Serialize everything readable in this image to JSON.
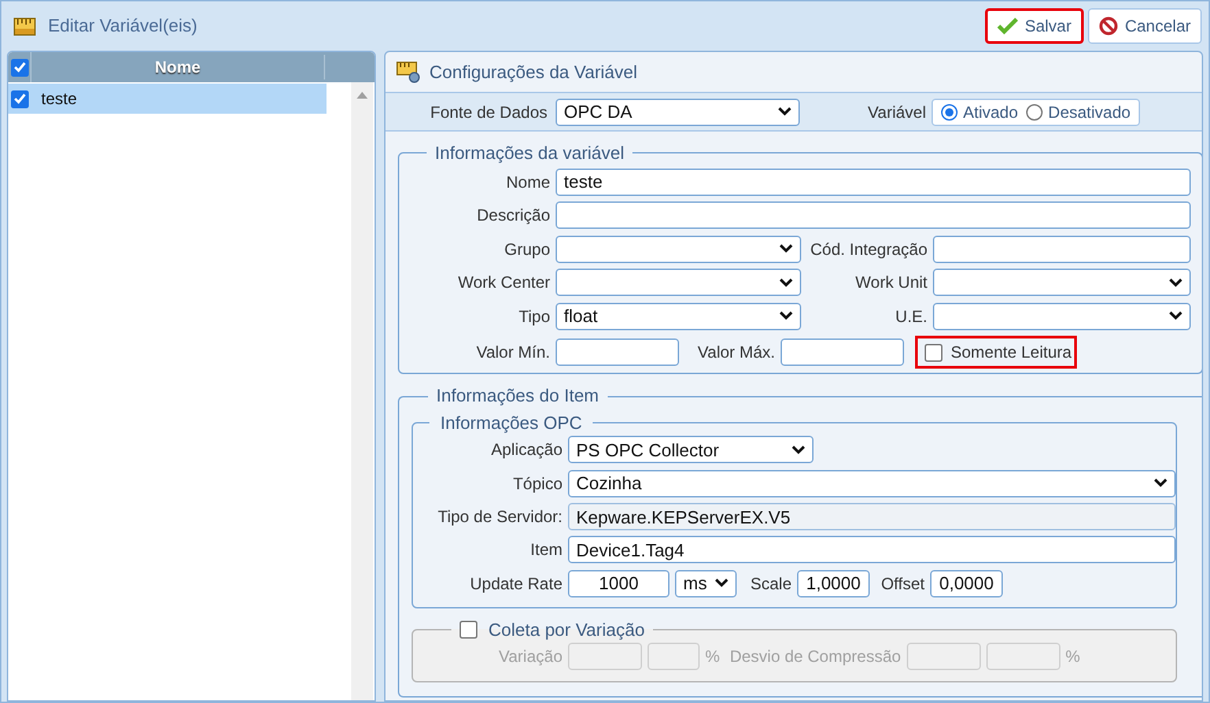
{
  "window": {
    "title": "Editar Variável(eis)"
  },
  "toolbar": {
    "buttons": [
      {
        "kind": "save",
        "label": "Salvar",
        "highlighted": true
      },
      {
        "kind": "cancel",
        "label": "Cancelar",
        "highlighted": false
      }
    ]
  },
  "list": {
    "header": {
      "label": "Nome",
      "checked": true
    },
    "rows": [
      {
        "label": "teste",
        "checked": true,
        "selected": true
      }
    ]
  },
  "config": {
    "title": "Configurações da Variável",
    "source": {
      "label": "Fonte de Dados",
      "value": "OPC DA"
    },
    "variable": {
      "label": "Variável",
      "options": [
        {
          "label": "Ativado",
          "selected": true
        },
        {
          "label": "Desativado",
          "selected": false
        }
      ]
    }
  },
  "variable_info": {
    "title": "Informações da variável",
    "name": {
      "label": "Nome",
      "value": "teste"
    },
    "description": {
      "label": "Descrição"
    },
    "group": {
      "label": "Grupo"
    },
    "integration_code": {
      "label": "Cód. Integração"
    },
    "work_center": {
      "label": "Work Center"
    },
    "work_unit": {
      "label": "Work Unit"
    },
    "type": {
      "label": "Tipo",
      "value": "float"
    },
    "unit": {
      "label": "U.E."
    },
    "min": {
      "label": "Valor Mín."
    },
    "max": {
      "label": "Valor Máx."
    },
    "read_only": {
      "label": "Somente Leitura",
      "checked": false,
      "highlighted": true
    }
  },
  "item_info": {
    "title": "Informações do Item",
    "opc": {
      "title": "Informações OPC",
      "application": {
        "label": "Aplicação",
        "value": "PS OPC Collector"
      },
      "topic": {
        "label": "Tópico",
        "value": "Cozinha"
      },
      "server_type": {
        "label": "Tipo de Servidor:",
        "value": "Kepware.KEPServerEX.V5"
      },
      "item": {
        "label": "Item",
        "value": "Device1.Tag4"
      },
      "update_rate": {
        "label": "Update Rate",
        "value": "1000",
        "unit": "ms"
      },
      "scale": {
        "label": "Scale",
        "value": "1,0000"
      },
      "offset": {
        "label": "Offset",
        "value": "0,0000"
      }
    },
    "variation": {
      "title": "Coleta por Variação",
      "checked": false,
      "variation": {
        "label": "Variação",
        "unit": "%"
      },
      "deviation": {
        "label": "Desvio de Compressão",
        "unit": "%"
      }
    }
  }
}
